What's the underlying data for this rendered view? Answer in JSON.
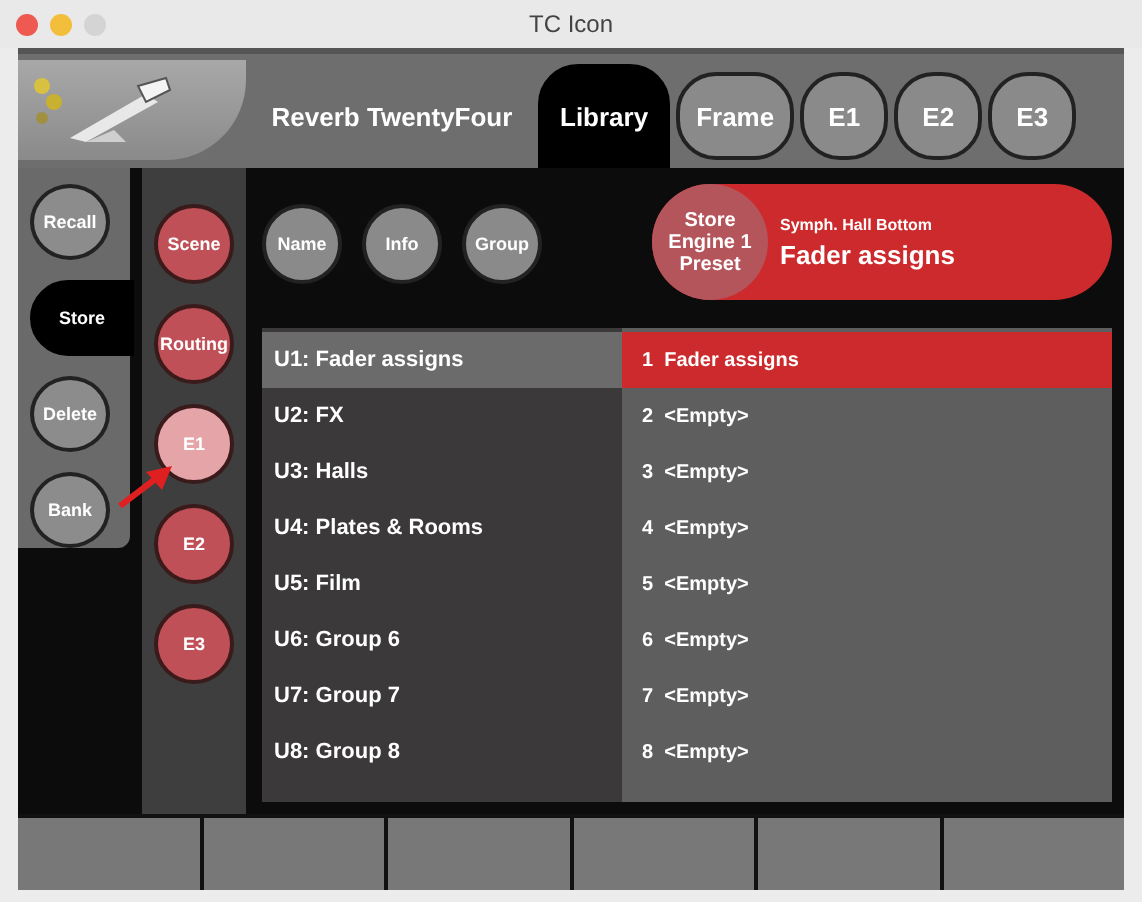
{
  "window": {
    "title": "TC Icon"
  },
  "header": {
    "product": "Reverb TwentyFour",
    "tabs": [
      {
        "label": "Library",
        "selected": true
      },
      {
        "label": "Frame",
        "selected": false
      },
      {
        "label": "E1",
        "selected": false
      },
      {
        "label": "E2",
        "selected": false
      },
      {
        "label": "E3",
        "selected": false
      }
    ]
  },
  "mode_buttons": [
    {
      "label": "Recall",
      "selected": false
    },
    {
      "label": "Store",
      "selected": true
    },
    {
      "label": "Delete",
      "selected": false
    },
    {
      "label": "Bank",
      "selected": false
    }
  ],
  "scope_buttons": [
    {
      "label": "Scene",
      "selected": false
    },
    {
      "label": "Routing",
      "selected": false
    },
    {
      "label": "E1",
      "selected": true
    },
    {
      "label": "E2",
      "selected": false
    },
    {
      "label": "E3",
      "selected": false
    }
  ],
  "action_buttons": [
    "Name",
    "Info",
    "Group"
  ],
  "preset_banner": {
    "action_lines": [
      "Store",
      "Engine 1",
      "Preset"
    ],
    "subtitle": "Symph. Hall Bottom",
    "name": "Fader assigns"
  },
  "banks": [
    {
      "id": "U1:",
      "name": "Fader assigns",
      "selected": true
    },
    {
      "id": "U2:",
      "name": "FX",
      "selected": false
    },
    {
      "id": "U3:",
      "name": "Halls",
      "selected": false
    },
    {
      "id": "U4:",
      "name": "Plates & Rooms",
      "selected": false
    },
    {
      "id": "U5:",
      "name": "Film",
      "selected": false
    },
    {
      "id": "U6:",
      "name": "Group 6",
      "selected": false
    },
    {
      "id": "U7:",
      "name": "Group 7",
      "selected": false
    },
    {
      "id": "U8:",
      "name": "Group 8",
      "selected": false
    }
  ],
  "slots": [
    {
      "number": "1",
      "name": "Fader assigns",
      "selected": true
    },
    {
      "number": "2",
      "name": "<Empty>",
      "selected": false
    },
    {
      "number": "3",
      "name": "<Empty>",
      "selected": false
    },
    {
      "number": "4",
      "name": "<Empty>",
      "selected": false
    },
    {
      "number": "5",
      "name": "<Empty>",
      "selected": false
    },
    {
      "number": "6",
      "name": "<Empty>",
      "selected": false
    },
    {
      "number": "7",
      "name": "<Empty>",
      "selected": false
    },
    {
      "number": "8",
      "name": "<Empty>",
      "selected": false
    }
  ]
}
